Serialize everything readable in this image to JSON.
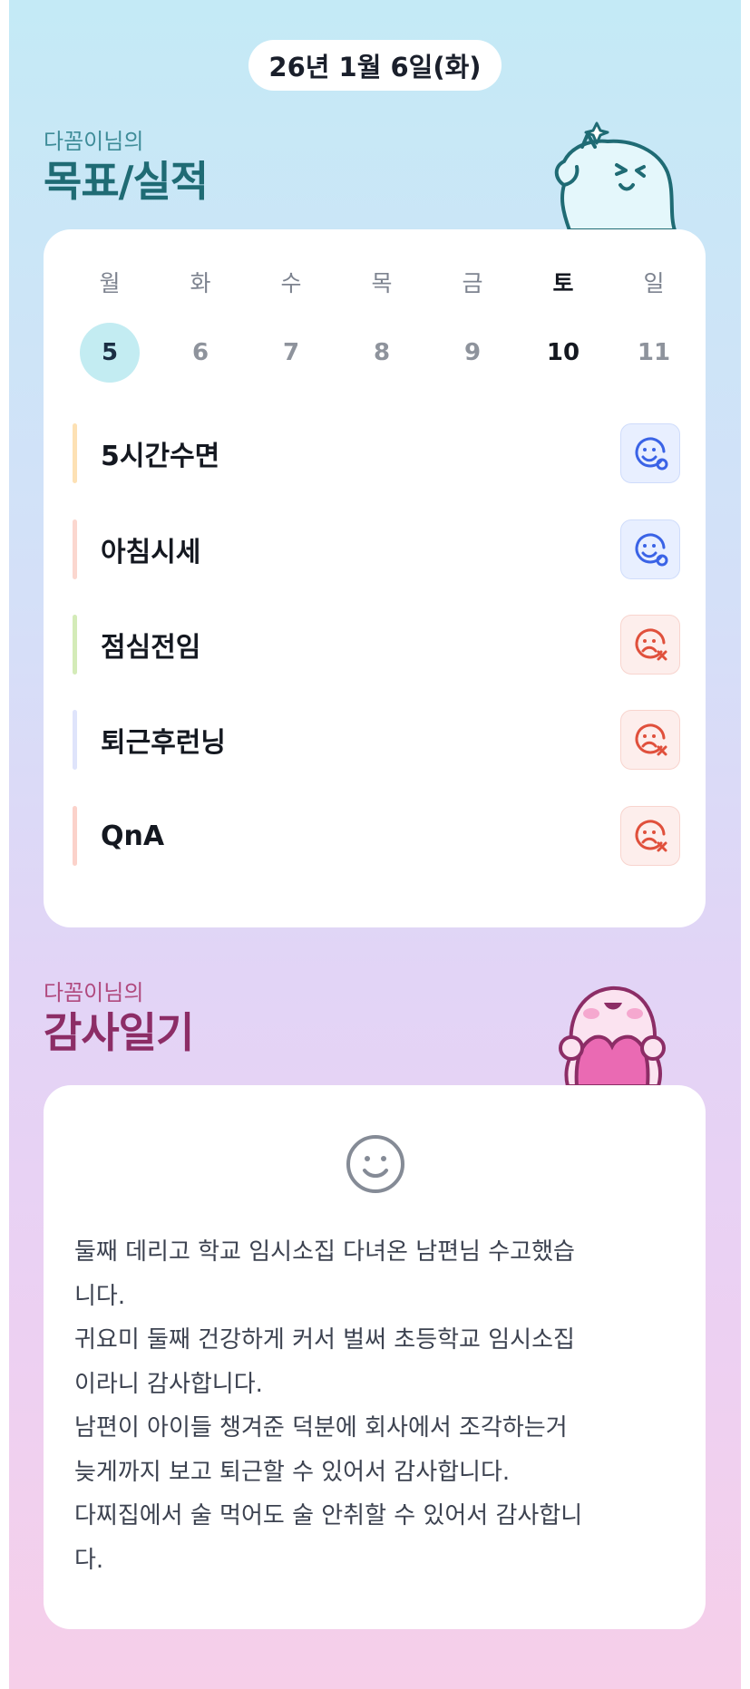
{
  "header": {
    "date": "26년 1월 6일(화)"
  },
  "goals_section": {
    "subtitle": "다꼼이님의",
    "title": "목표/실적",
    "week": [
      {
        "day": "월",
        "date": "5"
      },
      {
        "day": "화",
        "date": "6"
      },
      {
        "day": "수",
        "date": "7"
      },
      {
        "day": "목",
        "date": "8"
      },
      {
        "day": "금",
        "date": "9"
      },
      {
        "day": "토",
        "date": "10"
      },
      {
        "day": "일",
        "date": "11"
      }
    ],
    "selected_date": "5",
    "goals": [
      {
        "label": "5시간수면",
        "status": "smile-icon",
        "bar_color": "#fde1b4"
      },
      {
        "label": "아침시세",
        "status": "smile-icon",
        "bar_color": "#fbd7cf"
      },
      {
        "label": "점심전임",
        "status": "sad-icon",
        "bar_color": "#d4ebb8"
      },
      {
        "label": "퇴근후런닝",
        "status": "sad-icon",
        "bar_color": "#dfe4fb"
      },
      {
        "label": "QnA",
        "status": "sad-icon",
        "bar_color": "#fbd2ca"
      }
    ]
  },
  "diary_section": {
    "subtitle": "다꼼이님의",
    "title": "감사일기",
    "mood_icon": "smiley-face-icon",
    "lines": [
      "둘째 데리고 학교 임시소집 다녀온 남편님 수고했습",
      "니다.",
      "귀요미 둘째 건강하게 커서 벌써 초등학교 임시소집",
      "이라니 감사합니다.",
      "남편이 아이들 챙겨준 덕분에 회사에서 조각하는거",
      "늦게까지 보고 퇴근할 수 있어서 감사합니다.",
      "다찌집에서 술 먹어도 술 안취할 수 있어서 감사합니",
      "다."
    ]
  },
  "colors": {
    "teal_title": "#1f6b74",
    "pink_title": "#8c2d66",
    "success_blue": "#3a63e6",
    "fail_red": "#e0503c"
  }
}
